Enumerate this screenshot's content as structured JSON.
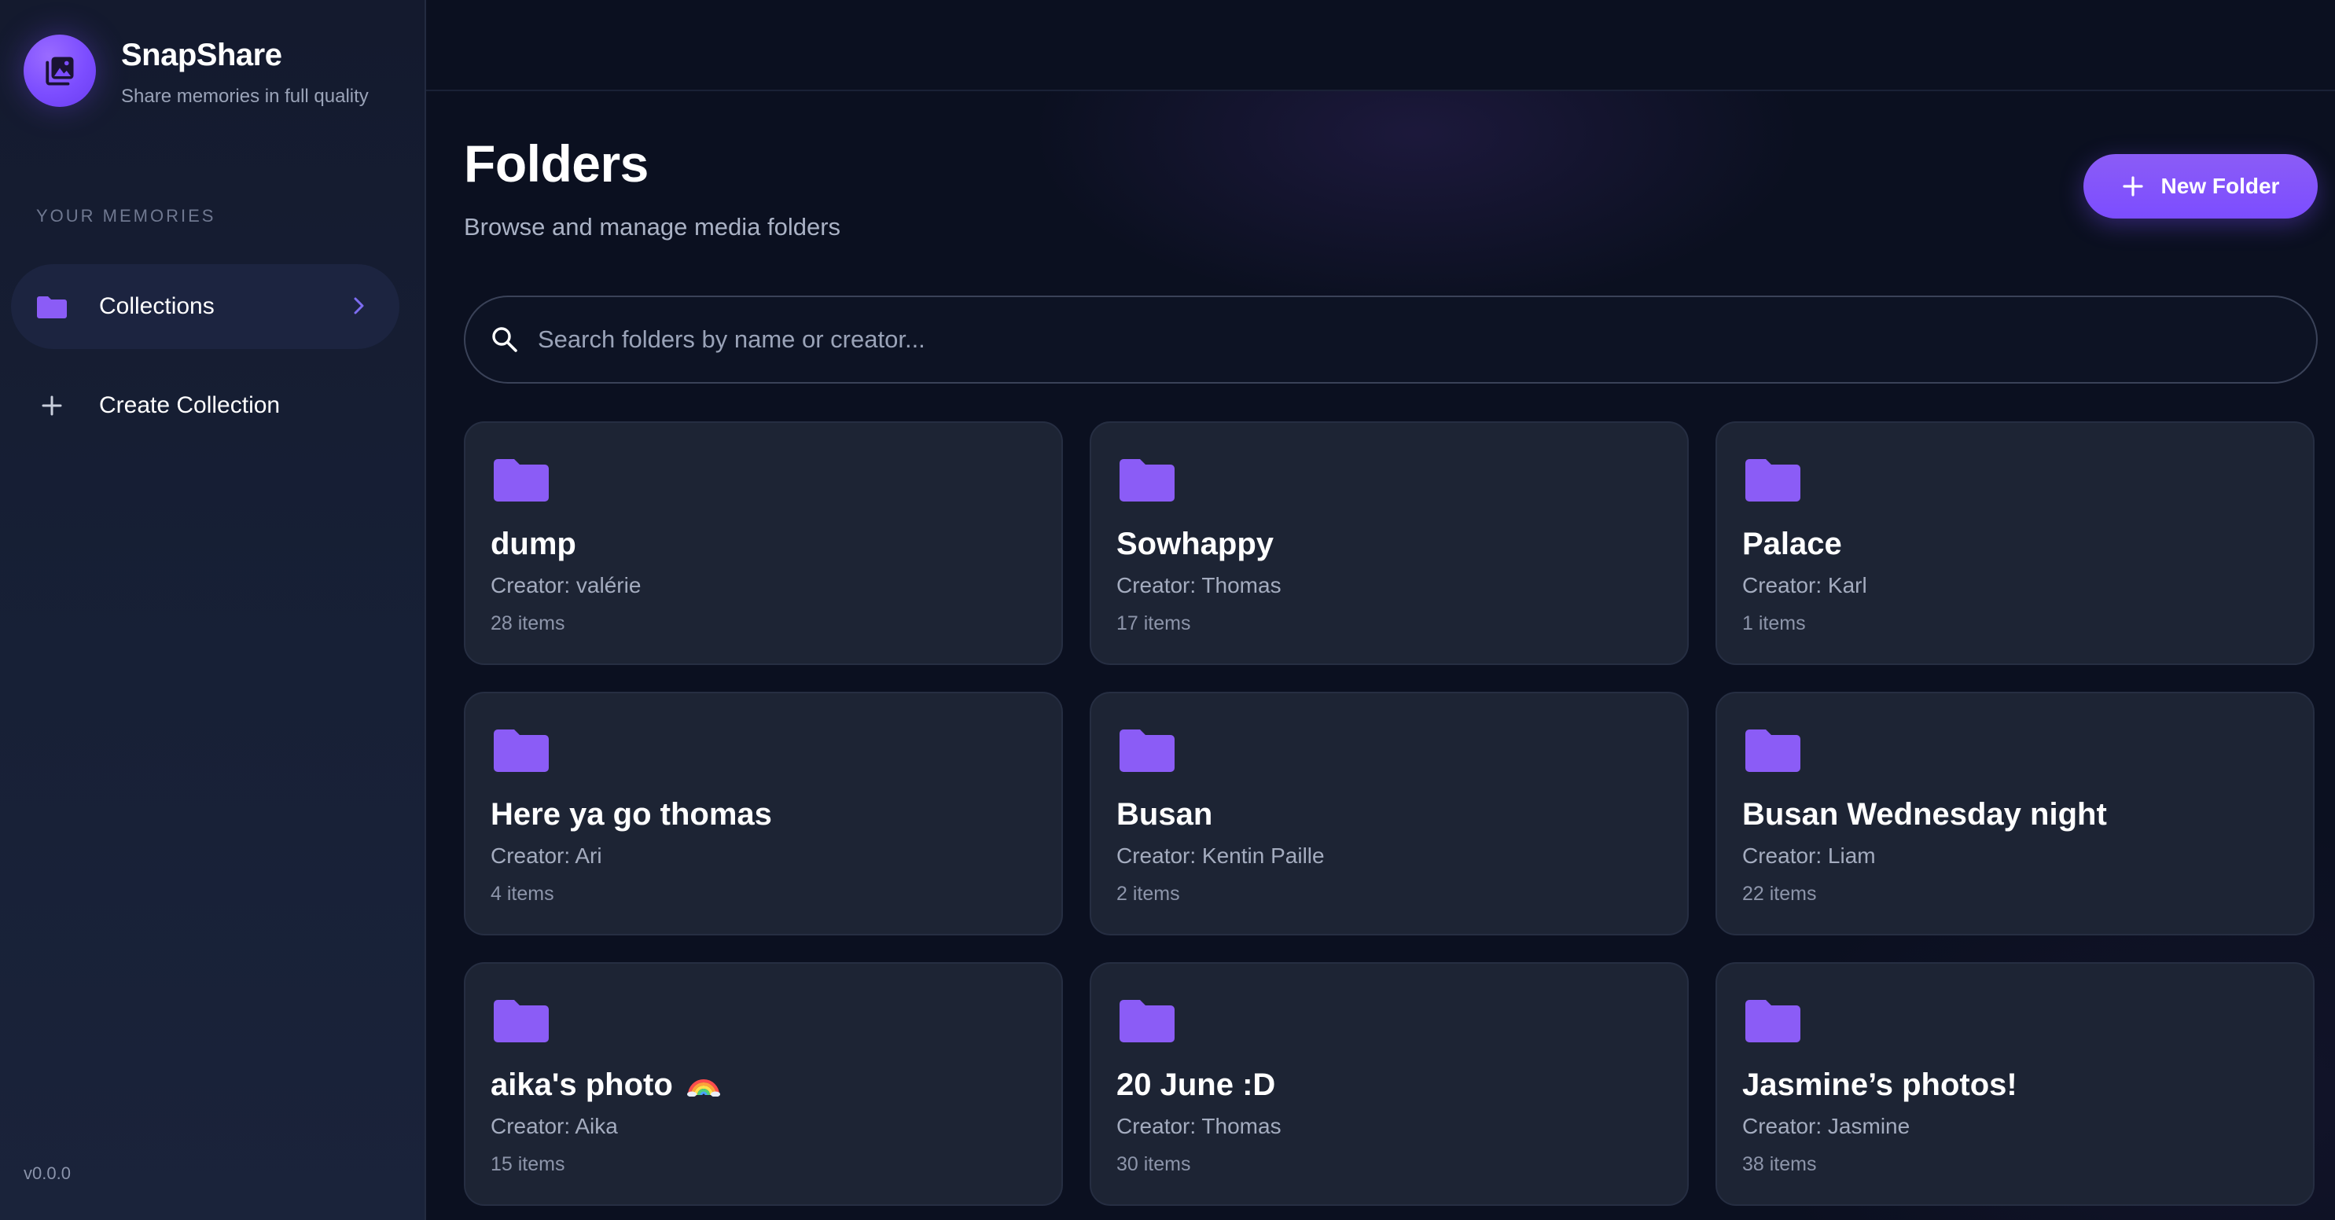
{
  "sidebar": {
    "app_name": "SnapShare",
    "tagline": "Share memories in full quality",
    "section_label": "YOUR MEMORIES",
    "nav": [
      {
        "label": "Collections",
        "icon": "folder-icon",
        "active": true
      },
      {
        "label": "Create Collection",
        "icon": "plus-icon",
        "active": false
      }
    ],
    "version": "v0.0.0"
  },
  "header": {
    "title": "Folders",
    "subtitle": "Browse and manage media folders",
    "new_folder_label": "New Folder"
  },
  "search": {
    "placeholder": "Search folders by name or creator...",
    "value": ""
  },
  "folders": [
    {
      "name": "dump",
      "creator": "Creator: valérie",
      "count": "28 items"
    },
    {
      "name": "Sowhappy",
      "creator": "Creator: Thomas",
      "count": "17 items"
    },
    {
      "name": "Palace",
      "creator": "Creator: Karl",
      "count": "1 items"
    },
    {
      "name": "Here ya go thomas",
      "creator": "Creator: Ari",
      "count": "4 items"
    },
    {
      "name": "Busan",
      "creator": "Creator: Kentin Paille",
      "count": "2 items"
    },
    {
      "name": "Busan Wednesday night",
      "creator": "Creator: Liam",
      "count": "22 items"
    },
    {
      "name": "aika's photo",
      "creator": "Creator: Aika",
      "count": "15 items"
    },
    {
      "name": "20 June :D",
      "creator": "Creator: Thomas",
      "count": "30 items"
    },
    {
      "name": "Jasmine’s photos!",
      "creator": "Creator: Jasmine",
      "count": "38 items"
    }
  ],
  "colors": {
    "accent": "#7c4dff",
    "background": "#0b1020",
    "card": "#1d2434",
    "sidebar": "#161d31"
  }
}
